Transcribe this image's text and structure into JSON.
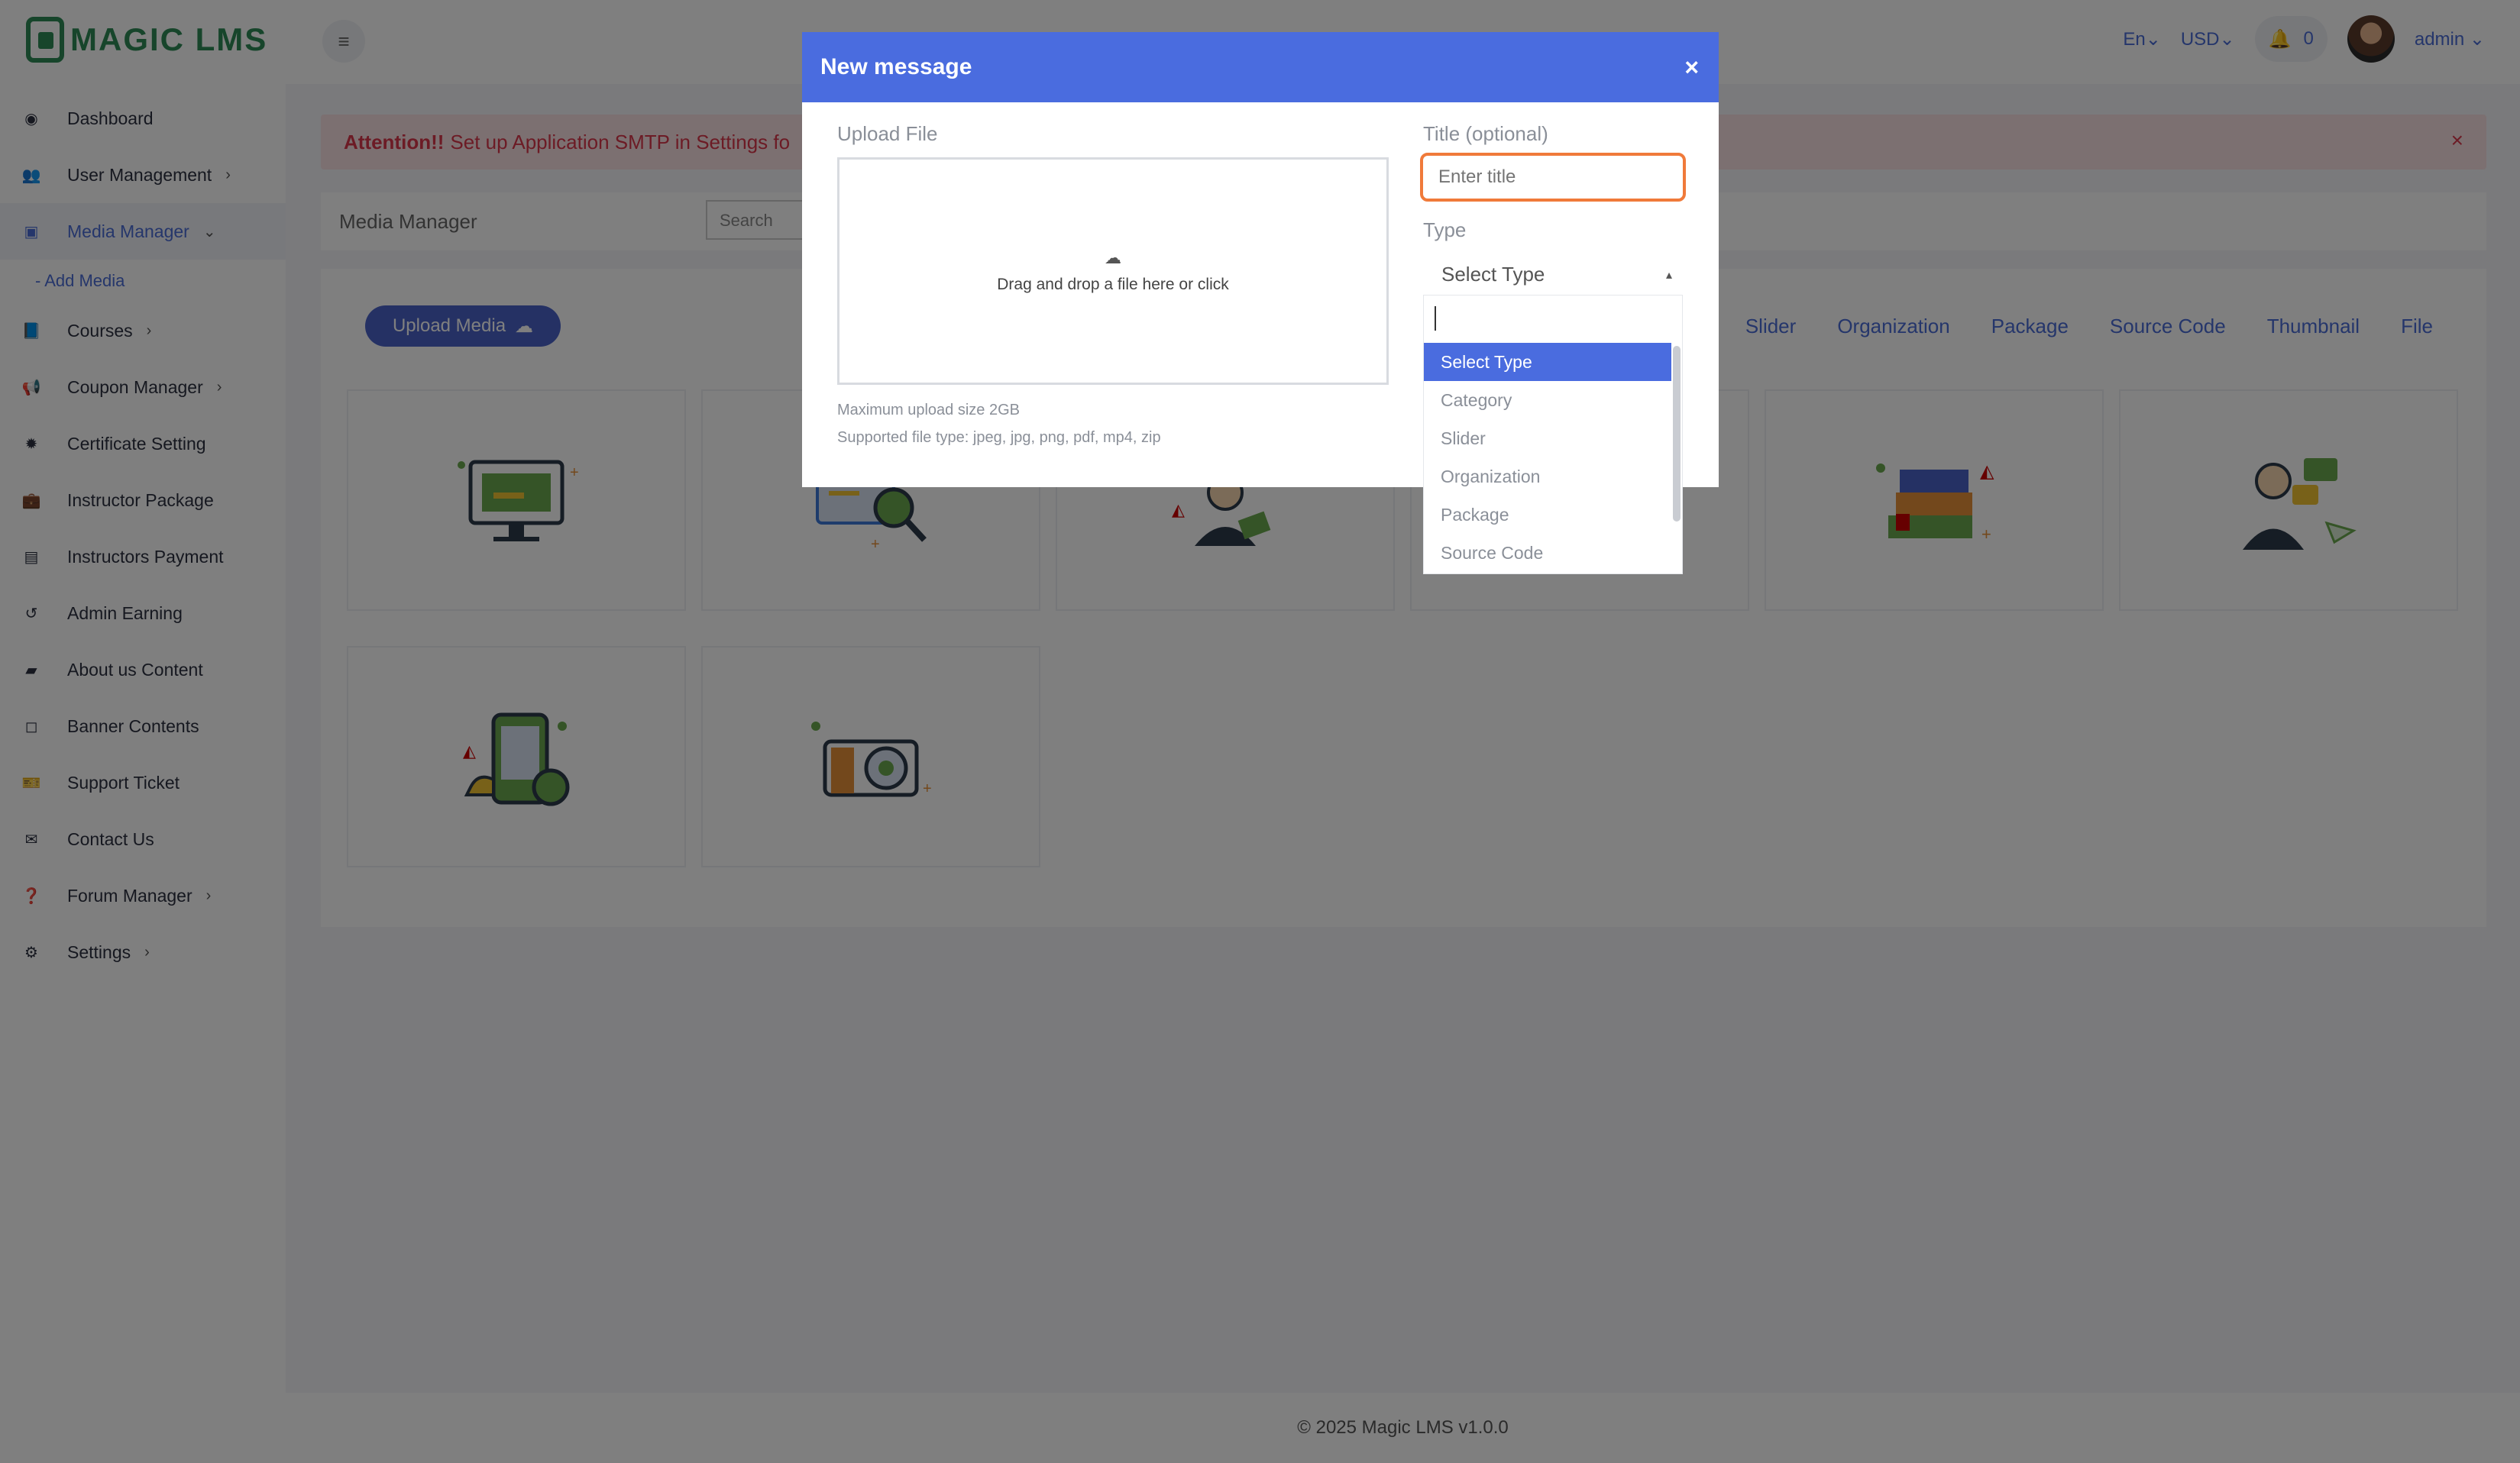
{
  "brand": {
    "name": "MAGIC LMS"
  },
  "sidebar": {
    "items": [
      {
        "label": "Dashboard",
        "icon": "dashboard-icon",
        "glyph": "◉",
        "chevron": false
      },
      {
        "label": "User Management",
        "icon": "users-icon",
        "glyph": "👥",
        "chevron": true
      },
      {
        "label": "Media Manager",
        "icon": "image-icon",
        "glyph": "▣",
        "chevron": true,
        "active": true
      },
      {
        "label": "Courses",
        "icon": "book-icon",
        "glyph": "📘",
        "chevron": true
      },
      {
        "label": "Coupon Manager",
        "icon": "megaphone-icon",
        "glyph": "📢",
        "chevron": true
      },
      {
        "label": "Certificate Setting",
        "icon": "certificate-icon",
        "glyph": "✹",
        "chevron": false
      },
      {
        "label": "Instructor Package",
        "icon": "briefcase-icon",
        "glyph": "💼",
        "chevron": false
      },
      {
        "label": "Instructors Payment",
        "icon": "money-icon",
        "glyph": "▤",
        "chevron": false
      },
      {
        "label": "Admin Earning",
        "icon": "history-icon",
        "glyph": "↺",
        "chevron": false
      },
      {
        "label": "About us Content",
        "icon": "book-open-icon",
        "glyph": "▰",
        "chevron": false
      },
      {
        "label": "Banner Contents",
        "icon": "note-icon",
        "glyph": "◻",
        "chevron": false
      },
      {
        "label": "Support Ticket",
        "icon": "ticket-icon",
        "glyph": "🎫",
        "chevron": false
      },
      {
        "label": "Contact Us",
        "icon": "envelope-open-icon",
        "glyph": "✉",
        "chevron": false
      },
      {
        "label": "Forum Manager",
        "icon": "question-icon",
        "glyph": "❓",
        "chevron": true
      },
      {
        "label": "Settings",
        "icon": "gear-icon",
        "glyph": "⚙",
        "chevron": true
      }
    ],
    "sub_item": "- Add Media",
    "chevron_glyph": "›",
    "active_chevron_glyph": "⌄"
  },
  "topbar": {
    "language": "En",
    "currency": "USD",
    "notifications": "0",
    "user": "admin",
    "menu_glyph": "≡",
    "bell_glyph": "🔔",
    "caret": "⌄"
  },
  "alert": {
    "strong": "Attention!!",
    "text": "Set up Application SMTP in Settings fo",
    "close": "×"
  },
  "media_manager": {
    "title": "Media Manager",
    "search_placeholder": "Search",
    "upload_button": "Upload Media",
    "upload_icon": "☁",
    "filters": [
      "Slider",
      "Organization",
      "Package",
      "Source Code",
      "Thumbnail",
      "File"
    ]
  },
  "footer": {
    "text": "© 2025 Magic LMS v1.0.0"
  },
  "modal": {
    "title": "New message",
    "close": "×",
    "upload_label": "Upload File",
    "drop_text": "Drag and drop a file here or click",
    "drop_icon": "☁",
    "max_size": "Maximum upload size 2GB",
    "file_types": "Supported file type: jpeg, jpg, png, pdf, mp4, zip",
    "title_label": "Title (optional)",
    "title_placeholder": "Enter title",
    "type_label": "Type",
    "type_selected": "Select Type",
    "type_caret": "▴",
    "options": [
      "Select Type",
      "Category",
      "Slider",
      "Organization",
      "Package",
      "Source Code"
    ]
  },
  "colors": {
    "primary": "#4a6cdf",
    "brand": "#2e8b57",
    "alert": "#d9374b",
    "focus": "#f07a3a"
  }
}
